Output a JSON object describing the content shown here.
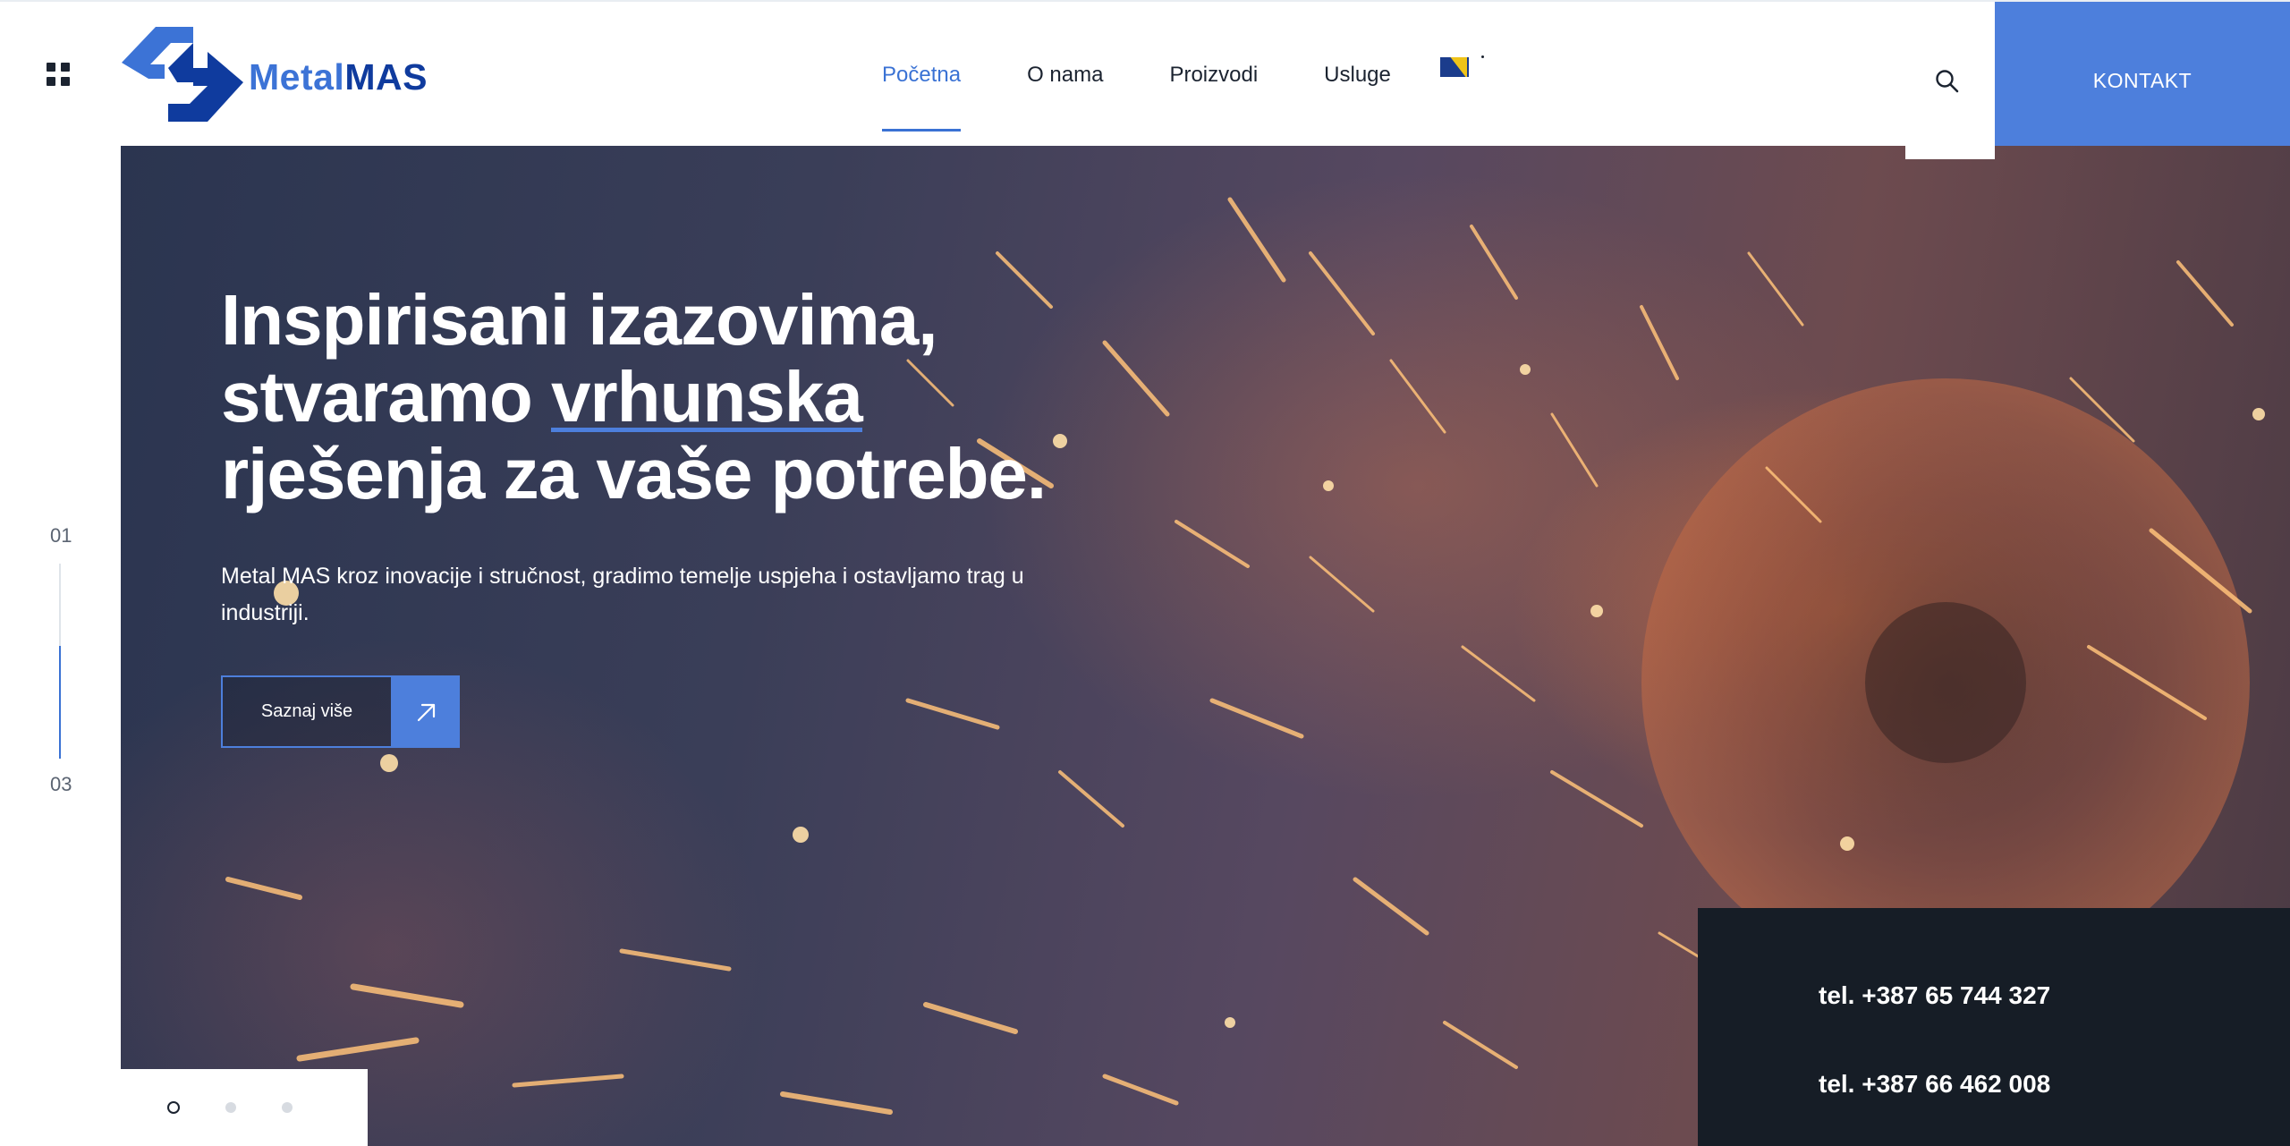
{
  "brand": {
    "name_part1": "Metal",
    "name_part2": "MAS",
    "primary_color": "#4d7fdc",
    "dark_color": "#0f3b9e"
  },
  "nav": {
    "items": [
      {
        "label": "Početna",
        "active": true
      },
      {
        "label": "O nama",
        "active": false
      },
      {
        "label": "Proizvodi",
        "active": false
      },
      {
        "label": "Usluge",
        "active": false
      }
    ],
    "language_flag_icon": "bosnia-flag-icon"
  },
  "header": {
    "search_icon": "search-icon",
    "contact_button": "KONTAKT"
  },
  "hero": {
    "title_line1": "Inspirisani izazovima,",
    "title_line2_a": "stvaramo",
    "title_line2_highlight": "vrhunska",
    "title_line3": "rješenja za vaše potrebe.",
    "description": "Metal MAS kroz inovacije i stručnost, gradimo temelje uspjeha i ostavljamo trag u industriji.",
    "button_label": "Saznaj više",
    "button_icon": "arrow-up-right-icon"
  },
  "slider": {
    "current": "01",
    "total": "03",
    "progress": 0.58,
    "dots": 3,
    "active_dot": 0
  },
  "contact": {
    "phone1": "tel. +387 65 744 327",
    "phone2": "tel. +387 66 462 008",
    "panel_color": "#161d26"
  }
}
